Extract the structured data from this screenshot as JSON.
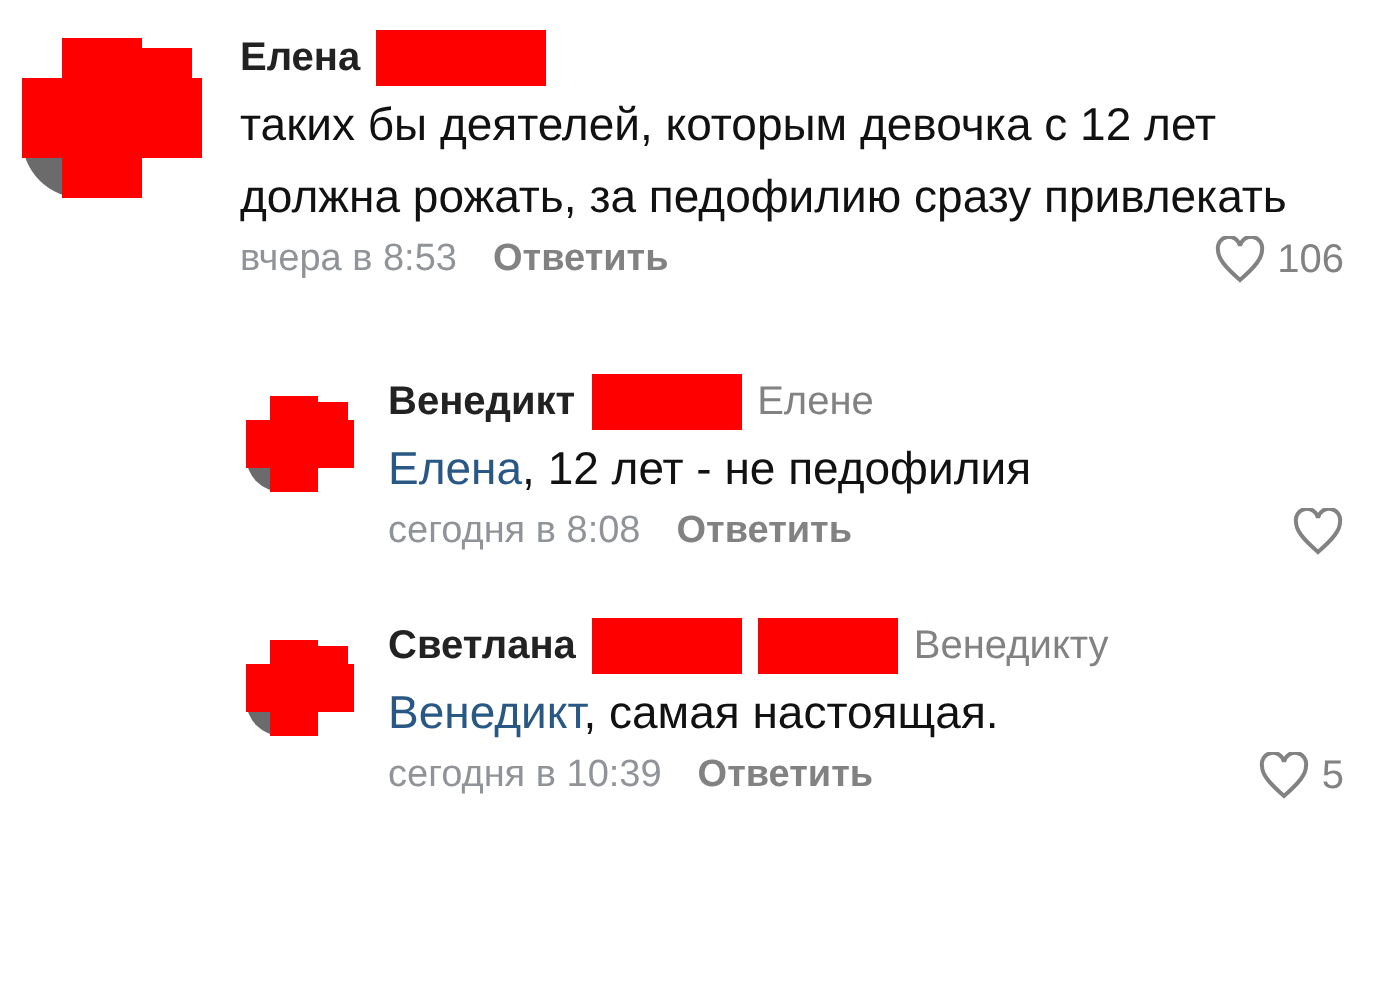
{
  "comments": [
    {
      "kind": "comment",
      "author": "Елена",
      "text": "таких бы деятелей, которым девочка с 12 лет должна рожать, за педофилию сразу привлекать",
      "time": "вчера в 8:53",
      "reply": "Ответить",
      "likes": "106"
    },
    {
      "kind": "reply",
      "author": "Венедикт",
      "addressee": "Елене",
      "mention": "Елена",
      "text": ", 12 лет - не педофилия",
      "time": "сегодня в 8:08",
      "reply": "Ответить"
    },
    {
      "kind": "reply",
      "author": "Светлана",
      "addressee": "Венедикту",
      "mention": "Венедикт",
      "text": ", самая настоящая.",
      "time": "сегодня в 10:39",
      "reply": "Ответить",
      "likes": "5"
    }
  ]
}
